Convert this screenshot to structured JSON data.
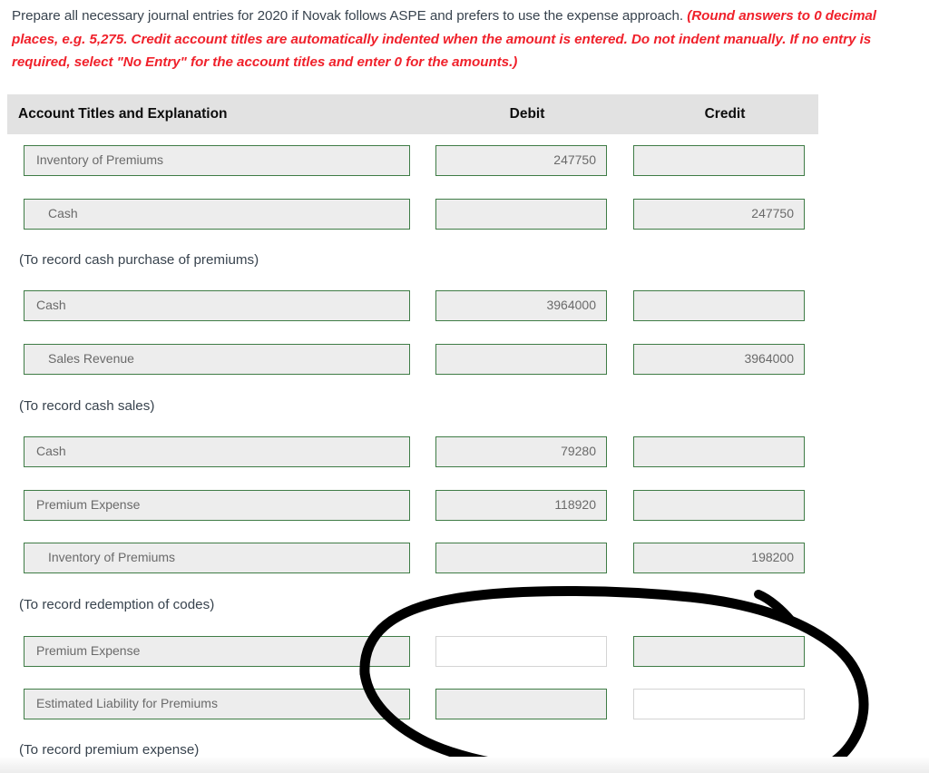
{
  "prompt": {
    "black_part": "Prepare all necessary journal entries for 2020 if Novak follows ASPE and prefers to use the expense approach. ",
    "red_part": "(Round answers to 0 decimal places, e.g. 5,275. Credit account titles are automatically indented when the amount is entered. Do not indent manually. If no entry is required, select \"No Entry\" for the account titles and enter 0 for the amounts.)",
    "red_color": "#f0212b"
  },
  "table": {
    "headers": {
      "account": "Account Titles and Explanation",
      "debit": "Debit",
      "credit": "Credit"
    },
    "header_bg": "#e2e2e2",
    "field_border_color": "#3f7c46",
    "field_bg": "#ededed",
    "blank_field_border_color": "#d4d4d4",
    "rows": [
      {
        "account": "Inventory of Premiums",
        "indent": false,
        "debit": "247750",
        "credit": "",
        "debit_blank": false,
        "credit_blank": false
      },
      {
        "account": "Cash",
        "indent": true,
        "debit": "",
        "credit": "247750",
        "debit_blank": false,
        "credit_blank": false
      },
      {
        "account": "Cash",
        "indent": false,
        "debit": "3964000",
        "credit": "",
        "debit_blank": false,
        "credit_blank": false
      },
      {
        "account": "Sales Revenue",
        "indent": true,
        "debit": "",
        "credit": "3964000",
        "debit_blank": false,
        "credit_blank": false
      },
      {
        "account": "Cash",
        "indent": false,
        "debit": "79280",
        "credit": "",
        "debit_blank": false,
        "credit_blank": false
      },
      {
        "account": "Premium Expense",
        "indent": false,
        "debit": "118920",
        "credit": "",
        "debit_blank": false,
        "credit_blank": false
      },
      {
        "account": "Inventory of Premiums",
        "indent": true,
        "debit": "",
        "credit": "198200",
        "debit_blank": false,
        "credit_blank": false
      },
      {
        "account": "Premium Expense",
        "indent": false,
        "debit": "",
        "credit": "",
        "debit_blank": true,
        "credit_blank": false
      },
      {
        "account": "Estimated Liability for Premiums",
        "indent": false,
        "debit": "",
        "credit": "",
        "debit_blank": false,
        "credit_blank": true
      }
    ],
    "captions": [
      "(To record cash purchase of premiums)",
      "(To record cash sales)",
      "(To record redemption of codes)",
      "(To record premium expense)"
    ]
  },
  "annotation": {
    "kind": "hand-drawn-circle",
    "color": "#000000",
    "description": "Black hand-drawn loop circling the empty Debit and Credit amount boxes of the last journal entry"
  }
}
